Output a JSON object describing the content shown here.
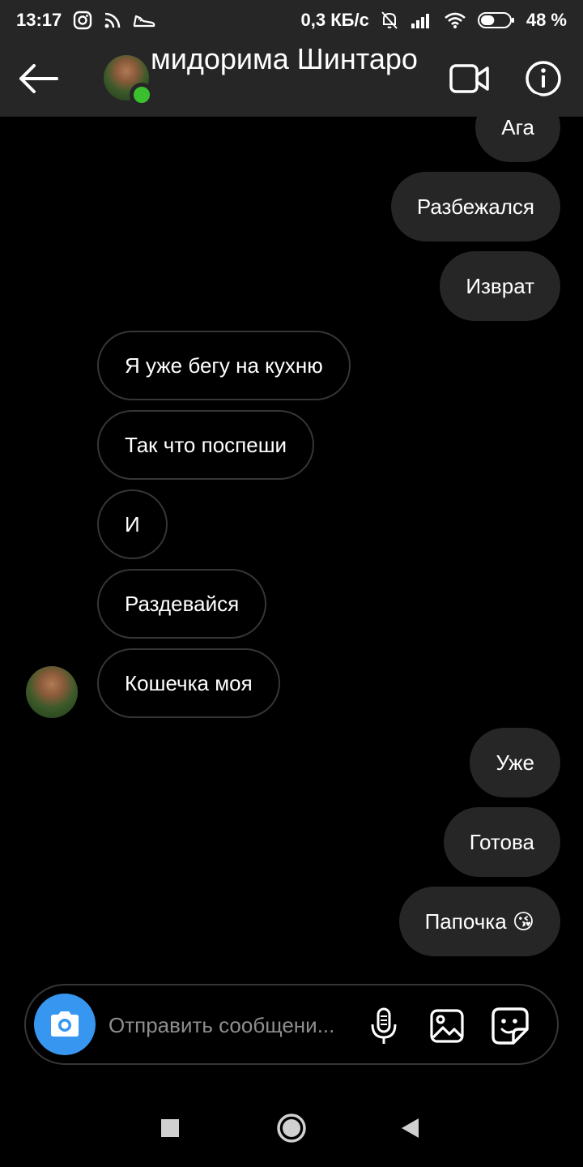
{
  "status_bar": {
    "time": "13:17",
    "left_icons": [
      "instagram-icon",
      "cast-icon",
      "sneaker-icon"
    ],
    "network_speed": "0,3 КБ/с",
    "right_icons": [
      "bell-off-icon",
      "signal-icon",
      "wifi-icon",
      "battery-icon"
    ],
    "battery": "48 %",
    "battery_level": 0.48
  },
  "header": {
    "title": "мидорима Шинтаро",
    "online": true,
    "online_color": "#3ac02e"
  },
  "messages": [
    {
      "text": "Ага",
      "direction": "outgoing"
    },
    {
      "text": "Разбежался",
      "direction": "outgoing"
    },
    {
      "text": "Изврат",
      "direction": "outgoing"
    },
    {
      "text": "Я уже бегу на кухню",
      "direction": "incoming"
    },
    {
      "text": "Так что поспеши",
      "direction": "incoming"
    },
    {
      "text": "И",
      "direction": "incoming"
    },
    {
      "text": "Раздевайся",
      "direction": "incoming"
    },
    {
      "text": "Кошечка моя",
      "direction": "incoming"
    },
    {
      "text": "Уже",
      "direction": "outgoing"
    },
    {
      "text": "Готова",
      "direction": "outgoing"
    },
    {
      "text": "Папочка 😘",
      "direction": "outgoing"
    }
  ],
  "composer": {
    "placeholder": "Отправить сообщени...",
    "value": "",
    "accent": "#3797f0"
  },
  "colors": {
    "background": "#000000",
    "bar": "#262626",
    "outgoing_bubble": "#262626",
    "incoming_border": "#363636"
  }
}
